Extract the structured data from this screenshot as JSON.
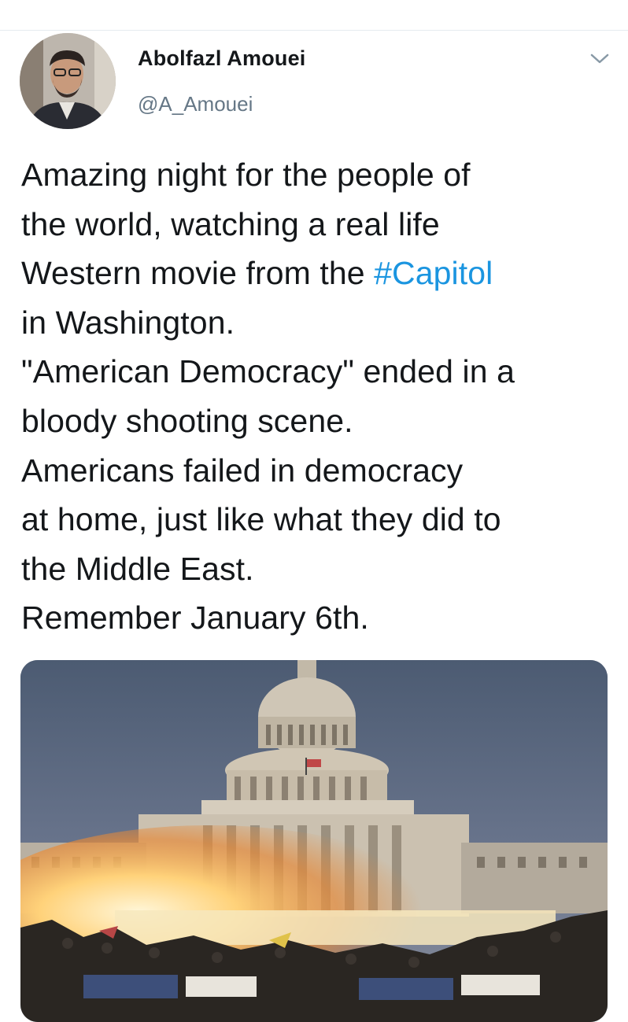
{
  "tweet": {
    "author": {
      "display_name": "Abolfazl Amouei",
      "handle": "@A_Amouei",
      "avatar_icon": "profile-photo"
    },
    "menu_icon": "chevron-down-icon",
    "text_before_hashtag": "Amazing night for the people of\nthe world, watching a real life\nWestern movie from the ",
    "hashtag": "#Capitol",
    "text_after_hashtag": "\nin Washington.\n\"American Democracy\" ended in a\nbloody shooting scene.\nAmericans failed in democracy\nat home, just like what they did to\nthe Middle East.\nRemember January 6th.",
    "media": {
      "kind": "photo",
      "subject": "US Capitol building at night with explosion and crowd"
    }
  },
  "colors": {
    "text": "#14171a",
    "secondary": "#657786",
    "link": "#1b95e0",
    "divider": "#e6ecf0"
  }
}
